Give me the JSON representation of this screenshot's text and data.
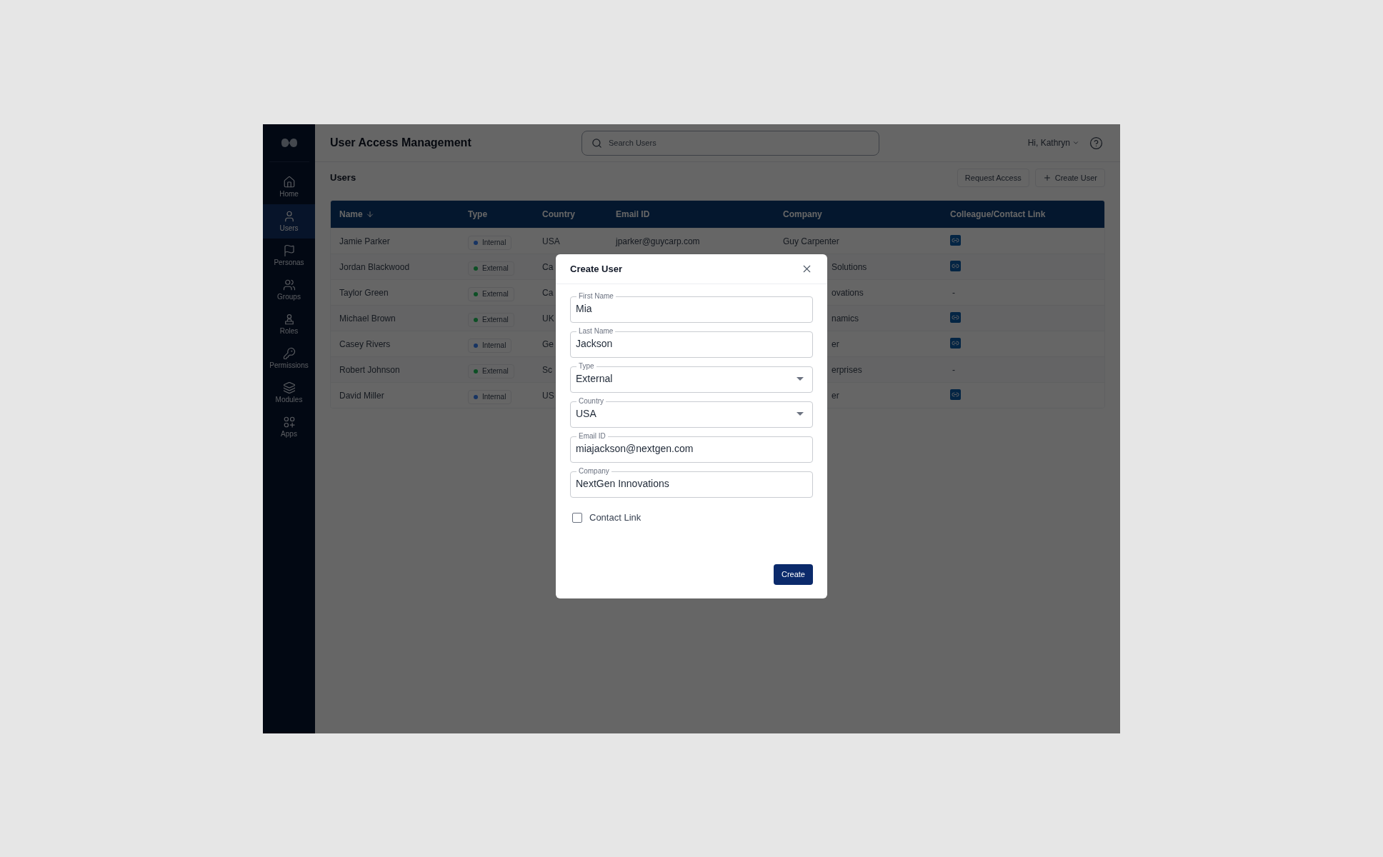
{
  "app": {
    "title": "User Access Management"
  },
  "search": {
    "placeholder": "Search Users"
  },
  "user_menu": {
    "greeting": "Hi, Kathryn"
  },
  "sidebar": {
    "items": [
      {
        "label": "Home",
        "selected": false
      },
      {
        "label": "Users",
        "selected": true
      },
      {
        "label": "Personas",
        "selected": false
      },
      {
        "label": "Groups",
        "selected": false
      },
      {
        "label": "Roles",
        "selected": false
      },
      {
        "label": "Permissions",
        "selected": false
      },
      {
        "label": "Modules",
        "selected": false
      },
      {
        "label": "Apps",
        "selected": false
      }
    ]
  },
  "page": {
    "title": "Users",
    "buttons": [
      {
        "label": "Request Access",
        "kind": "plain"
      },
      {
        "label": "Create User",
        "kind": "add"
      }
    ]
  },
  "table": {
    "columns": [
      {
        "label": "Name",
        "sorted": true
      },
      {
        "label": "Type",
        "sorted": false
      },
      {
        "label": "Country",
        "sorted": false
      },
      {
        "label": "Email ID",
        "sorted": false
      },
      {
        "label": "Company",
        "sorted": false
      },
      {
        "label": "Colleague/Contact Link",
        "sorted": false
      }
    ],
    "rows": [
      {
        "name": "Jamie Parker",
        "type": "Internal",
        "kind": "internal",
        "country": "USA",
        "email": "jparker@guycarp.com",
        "company": "Guy Carpenter",
        "contact": {
          "kind": "icon"
        }
      },
      {
        "name": "Jordan Blackwood",
        "type": "External",
        "kind": "external",
        "country": "Ca",
        "company": "Solutions",
        "contact": {
          "kind": "icon"
        }
      },
      {
        "name": "Taylor Green",
        "type": "External",
        "kind": "external",
        "country": "Ca",
        "company": "ovations",
        "contact": {
          "kind": "text",
          "text": "-"
        }
      },
      {
        "name": "Michael Brown",
        "type": "External",
        "kind": "external",
        "country": "UK",
        "company": "namics",
        "contact": {
          "kind": "icon"
        }
      },
      {
        "name": "Casey Rivers",
        "type": "Internal",
        "kind": "internal",
        "country": "Ge",
        "company": "er",
        "contact": {
          "kind": "icon"
        }
      },
      {
        "name": "Robert Johnson",
        "type": "External",
        "kind": "external",
        "country": "Sc",
        "company": "erprises",
        "contact": {
          "kind": "text",
          "text": "-"
        }
      },
      {
        "name": "David Miller",
        "type": "Internal",
        "kind": "internal",
        "country": "US",
        "company": "er",
        "contact": {
          "kind": "icon"
        }
      }
    ]
  },
  "dialog": {
    "title": "Create User",
    "fields": [
      {
        "label": "First Name",
        "value": "Mia",
        "kind": "text"
      },
      {
        "label": "Last Name",
        "value": "Jackson",
        "kind": "text"
      },
      {
        "label": "Type",
        "value": "External",
        "kind": "select"
      },
      {
        "label": "Country",
        "value": "USA",
        "kind": "select"
      },
      {
        "label": "Email ID",
        "value": "miajackson@nextgen.com",
        "kind": "text"
      },
      {
        "label": "Company",
        "value": "NextGen Innovations",
        "kind": "text"
      }
    ],
    "checkbox": {
      "label": "Contact Link",
      "checked": false
    },
    "submit": "Create"
  }
}
